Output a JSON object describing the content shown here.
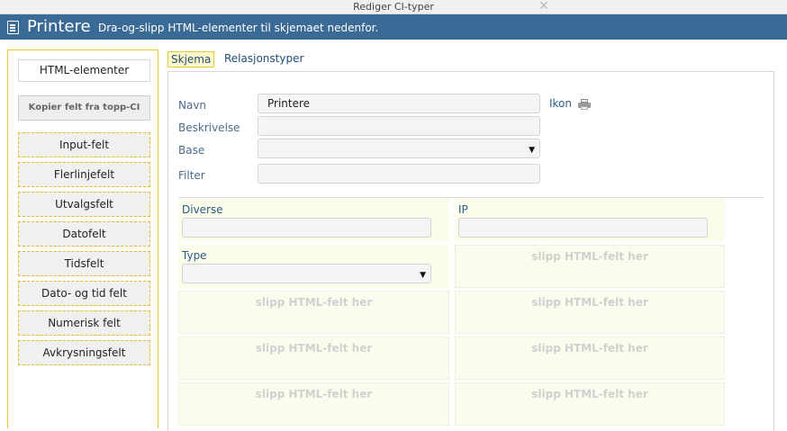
{
  "window": {
    "title": "Rediger CI-typer",
    "close_glyph": "✕"
  },
  "header": {
    "title": "Printere",
    "subtitle": "Dra-og-slipp HTML-elementer til skjemaet nedenfor.",
    "bg_color": "#3a6a96"
  },
  "palette": {
    "title": "HTML-elementer",
    "copy_button": "Kopier felt fra topp-CI",
    "items": [
      "Input-felt",
      "Flerlinjefelt",
      "Utvalgsfelt",
      "Datofelt",
      "Tidsfelt",
      "Dato- og tid felt",
      "Numerisk felt",
      "Avkrysningsfelt"
    ]
  },
  "tabs": [
    {
      "label": "Skjema",
      "active": true
    },
    {
      "label": "Relasjonstyper",
      "active": false
    }
  ],
  "form": {
    "fields": [
      {
        "label": "Navn",
        "value": "Printere"
      },
      {
        "label": "Beskrivelse",
        "value": ""
      },
      {
        "label": "Base",
        "value": "",
        "type": "select"
      },
      {
        "label": "Filter",
        "value": ""
      }
    ],
    "icon_label": "Ikon",
    "icon_name": "printer-icon"
  },
  "grid": {
    "diverse_label": "Diverse",
    "ip_label": "IP",
    "type_label": "Type",
    "drop_placeholder": "slipp HTML-felt her"
  }
}
